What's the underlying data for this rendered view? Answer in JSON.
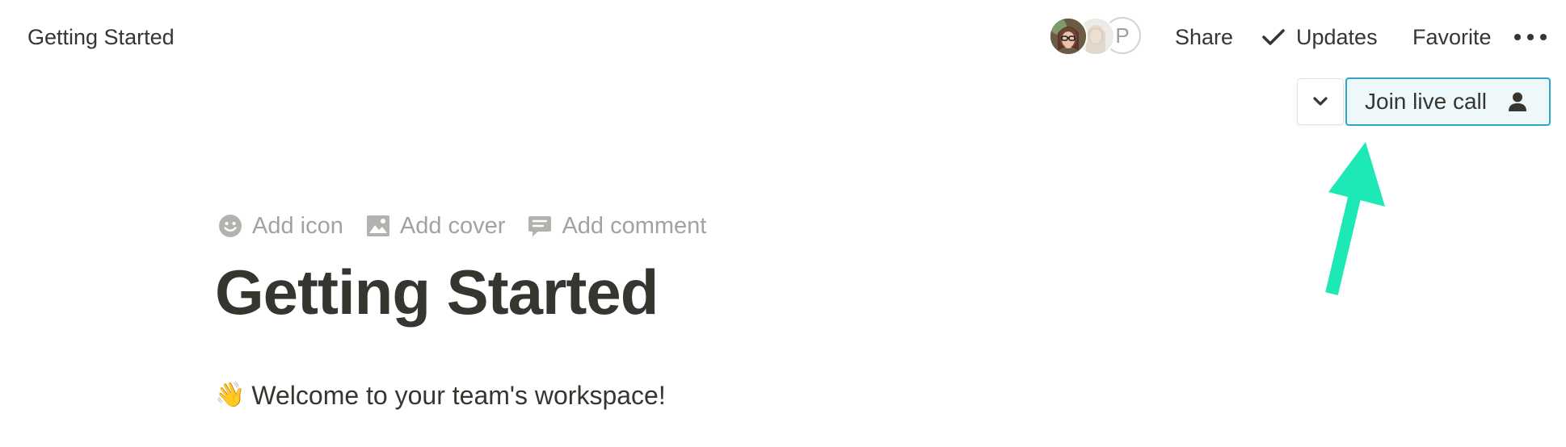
{
  "topbar": {
    "title": "Getting Started",
    "avatars": [
      {
        "name": "user-avatar-1"
      },
      {
        "name": "user-avatar-2"
      },
      {
        "initial": "P"
      }
    ],
    "share_label": "Share",
    "updates_label": "Updates",
    "favorite_label": "Favorite",
    "more_icon": "more-horizontal-icon"
  },
  "call": {
    "dropdown_icon": "chevron-down-icon",
    "join_label": "Join live call",
    "join_icon": "person-icon",
    "accent_border": "#2ea8c4",
    "accent_bg": "#eef7fa"
  },
  "page": {
    "actions": [
      {
        "label": "Add icon",
        "icon": "smiley-icon"
      },
      {
        "label": "Add cover",
        "icon": "image-icon"
      },
      {
        "label": "Add comment",
        "icon": "comment-icon"
      }
    ],
    "title": "Getting Started",
    "welcome_emoji": "👋",
    "welcome_text": "Welcome to your team's workspace!"
  },
  "annotation": {
    "arrow_color": "#1de9b6"
  }
}
